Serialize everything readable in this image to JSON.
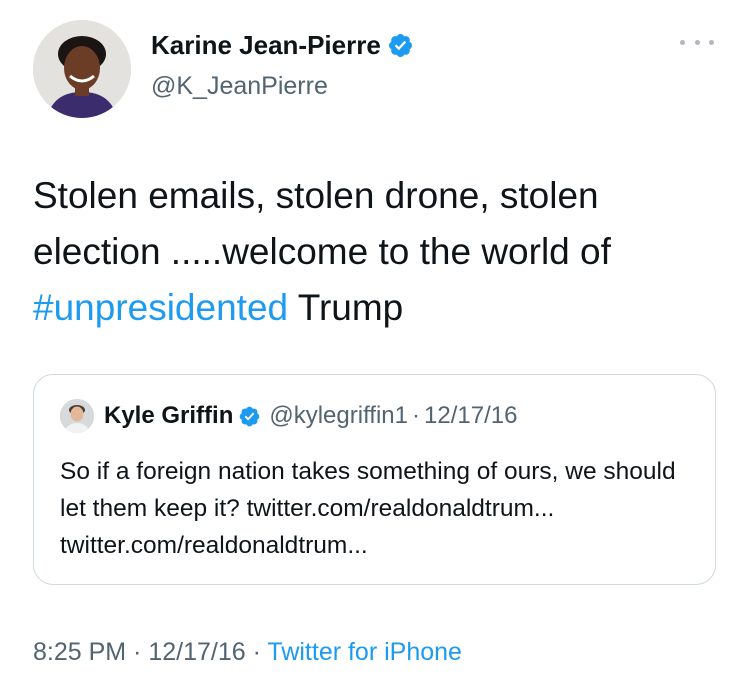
{
  "tweet": {
    "author": {
      "name": "Karine Jean-Pierre",
      "handle": "@K_JeanPierre",
      "verified_icon": "verified-badge-icon"
    },
    "more_icon": "more-dots-icon",
    "text": {
      "part1": "Stolen emails, stolen drone, stolen election .....welcome to the world of ",
      "hashtag": "#unpresidented",
      "part2": " Trump"
    },
    "quote": {
      "name": "Kyle Griffin",
      "handle": "@kylegriffin1",
      "separator": "·",
      "date": "12/17/16",
      "text": "So if a foreign nation takes something of ours, we should let them keep it? twitter.com/​realdonaldtrum... twitter.com/realdonaldtrum..."
    },
    "footer": {
      "time": "8:25 PM",
      "sep1": " · ",
      "date": "12/17/16",
      "sep2": " · ",
      "source": "Twitter for iPhone"
    }
  },
  "colors": {
    "link": "#1d9bf0",
    "secondary_text": "#536471",
    "primary_text": "#0f1419",
    "border": "#cfd9de"
  }
}
